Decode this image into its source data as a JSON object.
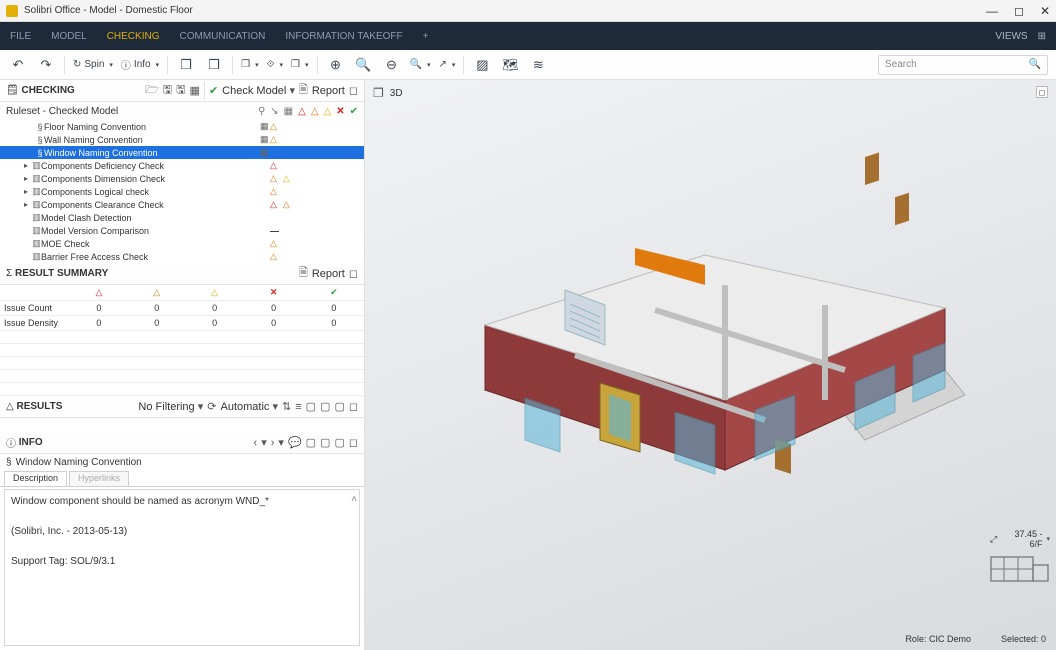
{
  "window": {
    "title": "Solibri Office - Model - Domestic Floor",
    "views_label": "VIEWS"
  },
  "menu": {
    "items": [
      "FILE",
      "MODEL",
      "CHECKING",
      "COMMUNICATION",
      "INFORMATION TAKEOFF",
      "+"
    ],
    "active": "CHECKING"
  },
  "toolbar": {
    "spin": "Spin",
    "info": "Info",
    "search_placeholder": "Search"
  },
  "checking": {
    "title": "CHECKING",
    "check_model": "Check Model",
    "report": "Report",
    "ruleset_label": "Ruleset - Checked Model",
    "rules": [
      {
        "indent": 2,
        "sec": "§",
        "name": "Floor Naming Convention",
        "tbl": true,
        "icons": [
          "orange"
        ]
      },
      {
        "indent": 2,
        "sec": "§",
        "name": "Wall Naming Convention",
        "tbl": true,
        "icons": [
          "orange"
        ]
      },
      {
        "indent": 2,
        "sec": "§",
        "name": "Window Naming Convention",
        "tbl": true,
        "icons": [],
        "selected": true
      },
      {
        "indent": 1,
        "caret": "▸",
        "pg": true,
        "name": "Components Deficiency Check",
        "icons": [
          "red"
        ]
      },
      {
        "indent": 1,
        "caret": "▸",
        "pg": true,
        "name": "Components Dimension Check",
        "icons": [
          "orange",
          "yellow"
        ]
      },
      {
        "indent": 1,
        "caret": "▸",
        "pg": true,
        "name": "Components Logical check",
        "icons": [
          "orange"
        ]
      },
      {
        "indent": 1,
        "caret": "▸",
        "pg": true,
        "name": "Components Clearance Check",
        "icons": [
          "red",
          "orange"
        ]
      },
      {
        "indent": 1,
        "caret": "",
        "pg": true,
        "name": "Model Clash Detection",
        "icons": []
      },
      {
        "indent": 1,
        "caret": "",
        "pg": true,
        "name": "Model Version Comparison",
        "icons": [
          "minus"
        ]
      },
      {
        "indent": 1,
        "caret": "",
        "pg": true,
        "name": "MOE Check",
        "icons": [
          "orange"
        ]
      },
      {
        "indent": 1,
        "caret": "",
        "pg": true,
        "name": "Barrier Free Access Check",
        "icons": [
          "orange"
        ]
      }
    ]
  },
  "summary": {
    "title": "RESULT SUMMARY",
    "report": "Report",
    "rows": [
      "Issue Count",
      "Issue Density"
    ],
    "cols_icons": [
      "red",
      "orange",
      "yellow",
      "x",
      "green"
    ],
    "values": [
      [
        "0",
        "0",
        "0",
        "0",
        "0"
      ],
      [
        "0",
        "0",
        "0",
        "0",
        "0"
      ]
    ]
  },
  "results": {
    "title": "RESULTS",
    "no_filtering": "No Filtering",
    "automatic": "Automatic"
  },
  "info": {
    "title": "INFO",
    "subject": "Window Naming Convention",
    "tabs": [
      "Description",
      "Hyperlinks"
    ],
    "body_line1": "Window component should be named as acronym WND_*",
    "body_line2": "(Solibri, Inc. - 2013-05-13)",
    "body_line3": "Support Tag: SOL/9/3.1"
  },
  "viewport": {
    "title": "3D",
    "floor_label": "37.45 - 6/F",
    "role": "Role: CIC Demo",
    "selected": "Selected: 0"
  }
}
